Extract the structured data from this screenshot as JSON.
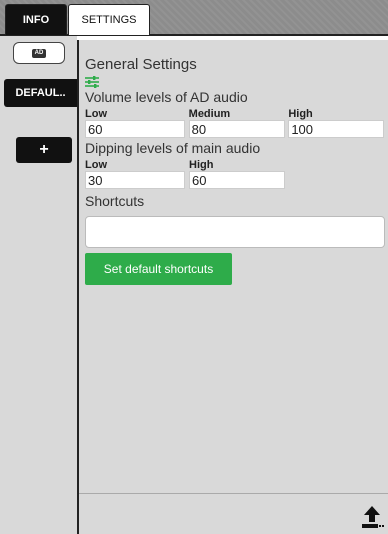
{
  "tabs": {
    "info_label": "INFO",
    "settings_label": "SETTINGS"
  },
  "rail": {
    "ad_label": "AD",
    "default_label": "DEFAUL..",
    "add_label": "+"
  },
  "general": {
    "title": "General Settings",
    "icon": "sliders-icon"
  },
  "volume": {
    "title": "Volume levels of AD audio",
    "low_label": "Low",
    "low_value": "60",
    "medium_label": "Medium",
    "medium_value": "80",
    "high_label": "High",
    "high_value": "100"
  },
  "dipping": {
    "title": "Dipping levels of main audio",
    "low_label": "Low",
    "low_value": "30",
    "high_label": "High",
    "high_value": "60"
  },
  "shortcuts": {
    "title": "Shortcuts",
    "value": "",
    "button_label": "Set default shortcuts"
  },
  "footer": {
    "icon": "upload-icon"
  },
  "colors": {
    "accent_green": "#2eac4a",
    "tab_active": "#111111",
    "panel_bg": "#d9d9d9"
  }
}
